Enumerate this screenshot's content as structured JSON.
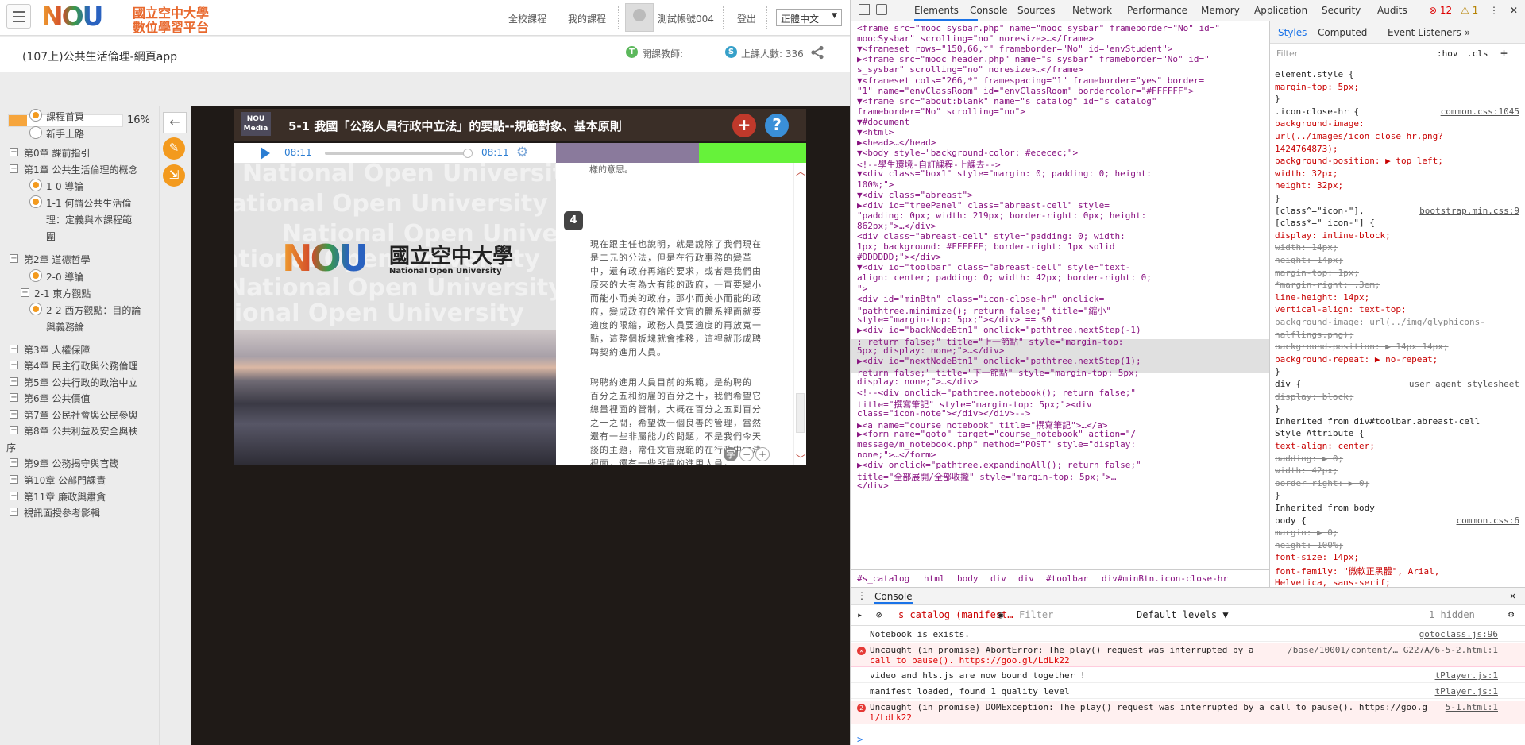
{
  "header": {
    "logo_mark": "NOU",
    "logo_line1": "國立空中大學",
    "logo_line2": "數位學習平台",
    "nav": [
      "全校課程",
      "我的課程",
      "測試帳號004",
      "登出"
    ],
    "language": "正體中文"
  },
  "course": {
    "title": "(107上)公共生活倫理-網頁app",
    "teacher_badge": "T",
    "teacher_label": "開課教師:",
    "students_badge": "S",
    "students_label": "上課人數: 336"
  },
  "tree": {
    "progress_percent": 16,
    "progress_label": "16%",
    "items": [
      {
        "type": "radio",
        "label": "課程首頁",
        "selected": true
      },
      {
        "type": "radio",
        "label": "新手上路",
        "selected": false
      },
      {
        "type": "folder",
        "label": "第0章 課前指引",
        "expanded": false
      },
      {
        "type": "folder",
        "label": "第1章 公共生活倫理的概念",
        "expanded": true
      },
      {
        "type": "radio",
        "label": "1-0 導論",
        "selected": true
      },
      {
        "type": "radio",
        "label": "1-1 何謂公共生活倫",
        "selected": true
      },
      {
        "type": "text",
        "label": "理：定義與本課程範"
      },
      {
        "type": "text",
        "label": "圍"
      },
      {
        "type": "folder",
        "label": "第2章 道德哲學",
        "expanded": true
      },
      {
        "type": "radio",
        "label": "2-0 導論",
        "selected": true
      },
      {
        "type": "folder",
        "label": "2-1 東方觀點",
        "expanded": false
      },
      {
        "type": "radio",
        "label": "2-2 西方觀點：目的論",
        "selected": true
      },
      {
        "type": "text",
        "label": "與義務論"
      },
      {
        "type": "folder",
        "label": "第3章 人權保障",
        "expanded": false
      },
      {
        "type": "folder",
        "label": "第4章 民主行政與公務倫理",
        "expanded": false
      },
      {
        "type": "folder",
        "label": "第5章 公共行政的政治中立",
        "expanded": false
      },
      {
        "type": "folder",
        "label": "第6章 公共價值",
        "expanded": false
      },
      {
        "type": "folder",
        "label": "第7章 公民社會與公民參與",
        "expanded": false
      },
      {
        "type": "folder",
        "label": "第8章 公共利益及安全與秩",
        "expanded": false
      },
      {
        "type": "text",
        "label": "序"
      },
      {
        "type": "folder",
        "label": "第9章 公務揭守與官箴",
        "expanded": false
      },
      {
        "type": "folder",
        "label": "第10章 公部門課責",
        "expanded": false
      },
      {
        "type": "folder",
        "label": "第11章 廉政與肅貪",
        "expanded": false
      },
      {
        "type": "folder",
        "label": "視訊面授參考影輯",
        "expanded": false
      }
    ]
  },
  "video": {
    "badge_line1": "NOU",
    "badge_line2": "Media",
    "title": "5-1 我國「公務人員行政中立法」的要點--規範對象、基本原則",
    "plus_icon": "+",
    "help_icon": "?",
    "time_current": "08:11",
    "time_total": "08:11",
    "watermark": "National Open University",
    "nou_zh": "國立空中大學",
    "nou_en": "National Open University"
  },
  "notes": {
    "prev_line": "樣的意思。",
    "number": "4",
    "paragraph1": [
      "現在跟主任也說明，就是說除了我們現在",
      "是二元的分法，但是在行政事務的變革",
      "中，還有政府再縮的要求，或者是我們由",
      "原來的大有為大有能的政府，一直要變小",
      "而能小而美的政府，那小而美小而能的政",
      "府，變成政府的常任文官的體系裡面就要",
      "適度的限縮，政務人員要適度的再放寬一",
      "點，這整個板塊就會推移，這裡就形成聘",
      "聘契約進用人員。"
    ],
    "paragraph2": [
      "聘聘約進用人員目前的規範，是約聘的",
      "百分之五和約雇的百分之十，我們希望它",
      "總量裡面的管制，大概在百分之五到百分",
      "之十之間，希望做一個良善的管理，當然",
      "還有一些非屬能力的問題，不是我們今天",
      "談的主題，常任文官規範的在行政中立法",
      "裡面，還有一些所謂的進用人員，"
    ],
    "zoom_labels": [
      "字",
      "−",
      "+"
    ]
  },
  "devtools": {
    "tabs": [
      "Elements",
      "Console",
      "Sources",
      "Network",
      "Performance",
      "Memory",
      "Application",
      "Security",
      "Audits"
    ],
    "errors": "12",
    "warnings": "1",
    "dom_lines": [
      "<frame src=\"mooc_sysbar.php\" name=\"mooc_sysbar\" frameborder=\"No\" id=\"",
      "moocSysbar\" scrolling=\"no\" noresize>…</frame>",
      "▼<frameset rows=\"150,66,*\" frameborder=\"No\" id=\"envStudent\">",
      "  ▶<frame src=\"mooc_header.php\" name=\"s_sysbar\" frameborder=\"No\" id=\"",
      "  s_sysbar\" scrolling=\"no\" noresize>…</frame>",
      "  ▼<frameset cols=\"266,*\" framespacing=\"1\" frameborder=\"yes\" border=",
      "  \"1\" name=\"envClassRoom\" id=\"envClassRoom\" bordercolor=\"#FFFFFF\">",
      "    ▼<frame src=\"about:blank\" name=\"s_catalog\" id=\"s_catalog\"",
      "    frameborder=\"No\" scrolling=\"no\">",
      "      ▼#document",
      "        ▼<html>",
      "          ▶<head>…</head>",
      "          ▼<body style=\"background-color: #ececec;\">",
      "              <!--學生環境-自訂課程-上課去-->",
      "            ▼<div class=\"box1\" style=\"margin: 0; padding: 0; height:",
      "            100%;\">",
      "              ▼<div class=\"abreast\">",
      "                ▶<div id=\"treePanel\" class=\"abreast-cell\" style=",
      "                \"padding: 0px; width: 219px; border-right: 0px; height:",
      "                862px;\">…</div>",
      "                  <div class=\"abreast-cell\" style=\"padding: 0; width:",
      "                  1px; background: #FFFFFF; border-right: 1px solid",
      "                  #DDDDDD;\"></div>",
      "                ▼<div id=\"toolbar\" class=\"abreast-cell\" style=\"text-",
      "                align: center; padding: 0; width: 42px; border-right: 0;",
      "                \">",
      "                    <div id=\"minBtn\" class=\"icon-close-hr\" onclick=",
      "                    \"pathtree.minimize(); return false;\" title=\"縮小\"",
      "                    style=\"margin-top: 5px;\"></div> == $0",
      "                  ▶<div id=\"backNodeBtn1\" onclick=\"pathtree.nextStep(-1)",
      "                  ; return false;\" title=\"上一節點\" style=\"margin-top:",
      "                  5px; display: none;\">…</div>",
      "                  ▶<div id=\"nextNodeBtn1\" onclick=\"pathtree.nextStep(1);",
      "                  return false;\" title=\"下一節點\" style=\"margin-top: 5px;",
      "                  display: none;\">…</div>",
      "                    <!--<div onclick=\"pathtree.notebook(); return false;\"",
      "                    title=\"撰寫筆記\" style=\"margin-top: 5px;\"><div",
      "                    class=\"icon-note\"></div></div>-->",
      "                  ▶<a name=\"course_notebook\" title=\"撰寫筆記\">…</a>",
      "                  ▶<form name=\"goto\" target=\"course_notebook\" action=\"/",
      "                  message/m_notebook.php\" method=\"POST\" style=\"display:",
      "                  none;\">…</form>",
      "                  ▶<div onclick=\"pathtree.expandingAll(); return false;\"",
      "                  title=\"全部展開/全部收攏\" style=\"margin-top: 5px;\">…",
      "                  </div>"
    ],
    "breadcrumbs": [
      "#s_catalog",
      "html",
      "body",
      "div",
      "div",
      "#toolbar",
      "div#minBtn.icon-close-hr"
    ],
    "style_tabs": [
      "Styles",
      "Computed",
      "Event Listeners",
      "»"
    ],
    "filter_placeholder": "Filter",
    "filter_hov": ":hov",
    "filter_cls": ".cls",
    "styles": [
      {
        "text": "element.style {",
        "src": ""
      },
      {
        "text": "  margin-top: 5px;",
        "src": ""
      },
      {
        "text": "}",
        "src": ""
      },
      {
        "text": ".icon-close-hr {",
        "src": "common.css:1045"
      },
      {
        "text": "  background-image:",
        "src": ""
      },
      {
        "text": "    url(../images/icon_close_hr.png?",
        "src": ""
      },
      {
        "text": "    1424764873);",
        "src": ""
      },
      {
        "text": "  background-position: ▶ top left;",
        "src": ""
      },
      {
        "text": "  width: 32px;",
        "src": ""
      },
      {
        "text": "  height: 32px;",
        "src": ""
      },
      {
        "text": "}",
        "src": ""
      },
      {
        "text": "[class^=\"icon-\"],",
        "src": "bootstrap.min.css:9"
      },
      {
        "text": "[class*=\" icon-\"] {",
        "src": ""
      },
      {
        "text": "  display: inline-block;",
        "src": ""
      },
      {
        "text": "  width: 14px;",
        "src": "",
        "strike": true
      },
      {
        "text": "  height: 14px;",
        "src": "",
        "strike": true
      },
      {
        "text": "  margin-top: 1px;",
        "src": "",
        "strike": true
      },
      {
        "text": "  *margin-right: .3em;",
        "src": "",
        "strike": true
      },
      {
        "text": "  line-height: 14px;",
        "src": ""
      },
      {
        "text": "  vertical-align: text-top;",
        "src": ""
      },
      {
        "text": "  background-image: url(../img/glyphicons-",
        "src": "",
        "strike": true
      },
      {
        "text": "    halflings.png);",
        "src": "",
        "strike": true
      },
      {
        "text": "  background-position: ▶ 14px 14px;",
        "src": "",
        "strike": true
      },
      {
        "text": "  background-repeat: ▶ no-repeat;",
        "src": ""
      },
      {
        "text": "}",
        "src": ""
      },
      {
        "text": "div {",
        "src": "user agent stylesheet"
      },
      {
        "text": "  display: block;",
        "src": "",
        "strike": true
      },
      {
        "text": "}",
        "src": ""
      },
      {
        "text": "Inherited from div#toolbar.abreast-cell",
        "src": ""
      },
      {
        "text": "Style Attribute {",
        "src": ""
      },
      {
        "text": "  text-align: center;",
        "src": ""
      },
      {
        "text": "  padding: ▶ 0;",
        "src": "",
        "strike": true
      },
      {
        "text": "  width: 42px;",
        "src": "",
        "strike": true
      },
      {
        "text": "  border-right: ▶ 0;",
        "src": "",
        "strike": true
      },
      {
        "text": "}",
        "src": ""
      },
      {
        "text": "Inherited from body",
        "src": ""
      },
      {
        "text": "body {",
        "src": "common.css:6"
      },
      {
        "text": "  margin: ▶ 0;",
        "src": "",
        "strike": true
      },
      {
        "text": "  height: 100%;",
        "src": "",
        "strike": true
      },
      {
        "text": "  font-size: 14px;",
        "src": ""
      },
      {
        "text": "  font-family: \"微軟正黑體\", Arial,",
        "src": ""
      },
      {
        "text": "    Helvetica, sans-serif;",
        "src": ""
      }
    ],
    "console_title": "Console",
    "console_context": "s_catalog (manifest…",
    "console_filter_placeholder": "Filter",
    "console_levels": "Default levels ▼",
    "console_hidden": "1 hidden",
    "console_messages": [
      {
        "level": "info",
        "text": "Notebook is exists.",
        "src": "gotoclass.js:96"
      },
      {
        "level": "error",
        "text": "Uncaught (in promise) AbortError: The play() request was interrupted by a",
        "text2": "call to pause(). https://goo.gl/LdLk22",
        "src": "/base/10001/content/… G227A/6-5-2.html:1"
      },
      {
        "level": "info",
        "text": "video and hls.js are now bound together !",
        "src": "tPlayer.js:1"
      },
      {
        "level": "info",
        "text": "manifest loaded, found 1 quality level",
        "src": "tPlayer.js:1"
      },
      {
        "level": "error",
        "count": "2",
        "text": "Uncaught (in promise) DOMException: The play() request was interrupted by a call to pause(). https://goo.g",
        "text2": "l/LdLk22",
        "src": "5-1.html:1"
      }
    ],
    "prompt": ">"
  }
}
